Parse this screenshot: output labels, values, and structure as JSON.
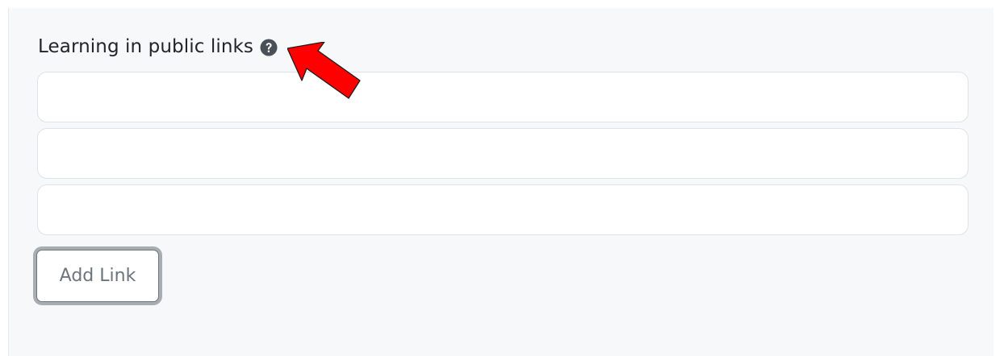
{
  "form": {
    "label": "Learning in public links",
    "help_icon": "question-circle-icon",
    "links": [
      {
        "value": "",
        "placeholder": ""
      },
      {
        "value": "",
        "placeholder": ""
      },
      {
        "value": "",
        "placeholder": ""
      }
    ],
    "add_button_label": "Add Link"
  },
  "annotation": {
    "icon": "red-arrow-pointer",
    "color": "#ff0000"
  },
  "colors": {
    "panel_background": "#f7f8f9",
    "text": "#212529",
    "button_text": "#6c757d",
    "help_icon": "#495057"
  }
}
